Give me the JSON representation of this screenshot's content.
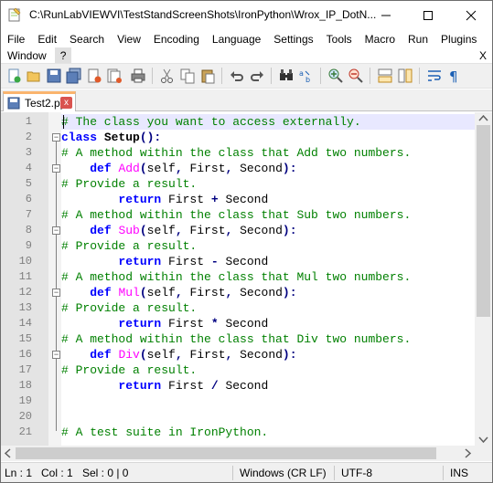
{
  "window": {
    "title": "C:\\RunLabVIEWVI\\TestStandScreenShots\\IronPython\\Wrox_IP_DotN..."
  },
  "menu": {
    "row1": [
      "File",
      "Edit",
      "Search",
      "View",
      "Encoding",
      "Language",
      "Settings",
      "Tools",
      "Macro",
      "Run",
      "Plugins"
    ],
    "row2": [
      "Window",
      "?"
    ],
    "close_label": "X"
  },
  "toolbar": {
    "icons": [
      "new-file-icon",
      "open-file-icon",
      "save-icon",
      "save-all-icon",
      "close-icon",
      "close-all-icon",
      "print-icon",
      "cut-icon",
      "copy-icon",
      "paste-icon",
      "undo-icon",
      "redo-icon",
      "find-icon",
      "replace-icon",
      "zoom-in-icon",
      "zoom-out-icon",
      "sync-vertical-icon",
      "sync-horizontal-icon",
      "word-wrap-icon",
      "show-all-chars-icon"
    ]
  },
  "tabs": [
    {
      "label": "Test2.py",
      "close": "x"
    }
  ],
  "editor": {
    "lines": [
      [
        {
          "t": "# The class you want to access externally.",
          "c": "cm"
        }
      ],
      [
        {
          "t": "class ",
          "c": "kw"
        },
        {
          "t": "Setup",
          "c": "cl"
        },
        {
          "t": "():",
          "c": "op"
        }
      ],
      [
        {
          "t": "# A method within the class that Add two numbers.",
          "c": "cm"
        }
      ],
      [
        {
          "t": "    ",
          "c": "tx"
        },
        {
          "t": "def ",
          "c": "kw"
        },
        {
          "t": "Add",
          "c": "fn"
        },
        {
          "t": "(",
          "c": "op"
        },
        {
          "t": "self",
          "c": "tx"
        },
        {
          "t": ", ",
          "c": "op"
        },
        {
          "t": "First",
          "c": "tx"
        },
        {
          "t": ", ",
          "c": "op"
        },
        {
          "t": "Second",
          "c": "tx"
        },
        {
          "t": "):",
          "c": "op"
        }
      ],
      [
        {
          "t": "# Provide a result.",
          "c": "cm"
        }
      ],
      [
        {
          "t": "        ",
          "c": "tx"
        },
        {
          "t": "return ",
          "c": "kw"
        },
        {
          "t": "First ",
          "c": "tx"
        },
        {
          "t": "+",
          "c": "op"
        },
        {
          "t": " Second",
          "c": "tx"
        }
      ],
      [
        {
          "t": "# A method within the class that Sub two numbers.",
          "c": "cm"
        }
      ],
      [
        {
          "t": "    ",
          "c": "tx"
        },
        {
          "t": "def ",
          "c": "kw"
        },
        {
          "t": "Sub",
          "c": "fn"
        },
        {
          "t": "(",
          "c": "op"
        },
        {
          "t": "self",
          "c": "tx"
        },
        {
          "t": ", ",
          "c": "op"
        },
        {
          "t": "First",
          "c": "tx"
        },
        {
          "t": ", ",
          "c": "op"
        },
        {
          "t": "Second",
          "c": "tx"
        },
        {
          "t": "):",
          "c": "op"
        }
      ],
      [
        {
          "t": "# Provide a result.",
          "c": "cm"
        }
      ],
      [
        {
          "t": "        ",
          "c": "tx"
        },
        {
          "t": "return ",
          "c": "kw"
        },
        {
          "t": "First ",
          "c": "tx"
        },
        {
          "t": "-",
          "c": "op"
        },
        {
          "t": " Second",
          "c": "tx"
        }
      ],
      [
        {
          "t": "# A method within the class that Mul two numbers.",
          "c": "cm"
        }
      ],
      [
        {
          "t": "    ",
          "c": "tx"
        },
        {
          "t": "def ",
          "c": "kw"
        },
        {
          "t": "Mul",
          "c": "fn"
        },
        {
          "t": "(",
          "c": "op"
        },
        {
          "t": "self",
          "c": "tx"
        },
        {
          "t": ", ",
          "c": "op"
        },
        {
          "t": "First",
          "c": "tx"
        },
        {
          "t": ", ",
          "c": "op"
        },
        {
          "t": "Second",
          "c": "tx"
        },
        {
          "t": "):",
          "c": "op"
        }
      ],
      [
        {
          "t": "# Provide a result.",
          "c": "cm"
        }
      ],
      [
        {
          "t": "        ",
          "c": "tx"
        },
        {
          "t": "return ",
          "c": "kw"
        },
        {
          "t": "First ",
          "c": "tx"
        },
        {
          "t": "*",
          "c": "op"
        },
        {
          "t": " Second",
          "c": "tx"
        }
      ],
      [
        {
          "t": "# A method within the class that Div two numbers.",
          "c": "cm"
        }
      ],
      [
        {
          "t": "    ",
          "c": "tx"
        },
        {
          "t": "def ",
          "c": "kw"
        },
        {
          "t": "Div",
          "c": "fn"
        },
        {
          "t": "(",
          "c": "op"
        },
        {
          "t": "self",
          "c": "tx"
        },
        {
          "t": ", ",
          "c": "op"
        },
        {
          "t": "First",
          "c": "tx"
        },
        {
          "t": ", ",
          "c": "op"
        },
        {
          "t": "Second",
          "c": "tx"
        },
        {
          "t": "):",
          "c": "op"
        }
      ],
      [
        {
          "t": "# Provide a result.",
          "c": "cm"
        }
      ],
      [
        {
          "t": "        ",
          "c": "tx"
        },
        {
          "t": "return ",
          "c": "kw"
        },
        {
          "t": "First ",
          "c": "tx"
        },
        {
          "t": "/",
          "c": "op"
        },
        {
          "t": " Second",
          "c": "tx"
        }
      ],
      [],
      [],
      [
        {
          "t": "# A test suite in IronPython.",
          "c": "cm"
        }
      ]
    ],
    "line_numbers": [
      "1",
      "2",
      "3",
      "4",
      "5",
      "6",
      "7",
      "8",
      "9",
      "10",
      "11",
      "12",
      "13",
      "14",
      "15",
      "16",
      "17",
      "18",
      "19",
      "20",
      "21"
    ]
  },
  "status": {
    "ln": "Ln : 1",
    "col": "Col : 1",
    "sel": "Sel : 0 | 0",
    "eol": "Windows (CR LF)",
    "encoding": "UTF-8",
    "mode": "INS"
  },
  "colors": {
    "comment": "#008000",
    "keyword": "#0000ff",
    "function": "#ff00ff",
    "current_line": "#e8e8ff",
    "tab_accent": "#fab46e"
  }
}
